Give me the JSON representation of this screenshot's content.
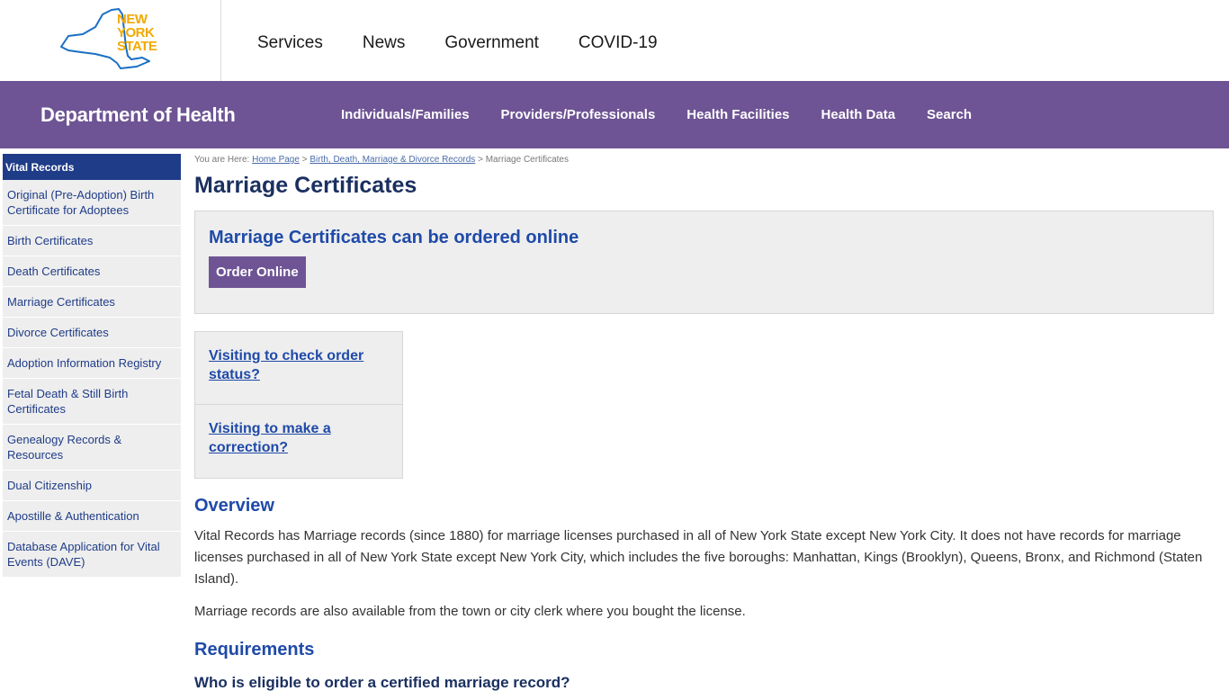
{
  "header": {
    "logo_lines": [
      "NEW",
      "YORK",
      "STATE"
    ],
    "nav": [
      "Services",
      "News",
      "Government",
      "COVID-19"
    ]
  },
  "dept_bar": {
    "title": "Department of Health",
    "nav": [
      "Individuals/Families",
      "Providers/Professionals",
      "Health Facilities",
      "Health Data",
      "Search"
    ]
  },
  "sidebar": {
    "heading": "Vital Records",
    "items": [
      "Original (Pre-Adoption) Birth Certificate for Adoptees",
      "Birth Certificates",
      "Death Certificates",
      "Marriage Certificates",
      "Divorce Certificates",
      "Adoption Information Registry",
      "Fetal Death & Still Birth Certificates",
      "Genealogy Records & Resources",
      "Dual Citizenship",
      "Apostille & Authentication",
      "Database Application for Vital Events (DAVE)"
    ]
  },
  "breadcrumb": {
    "prefix": "You are Here:",
    "home": "Home Page",
    "sep": ">",
    "section": "Birth, Death, Marriage & Divorce Records",
    "current": "Marriage Certificates"
  },
  "main": {
    "title": "Marriage Certificates",
    "order_heading": "Marriage Certificates can be ordered online",
    "order_button": "Order Online",
    "visit_links": [
      "Visiting to check order status?",
      "Visiting to make a correction?"
    ],
    "overview_heading": "Overview",
    "overview_p1": "Vital Records has Marriage records (since 1880) for marriage licenses purchased in all of New York State except New York City. It does not have records for marriage licenses purchased in all of New York State except New York City, which includes the five boroughs: Manhattan, Kings (Brooklyn), Queens, Bronx, and Richmond (Staten Island).",
    "overview_p2": "Marriage records are also available from the town or city clerk where you bought the license.",
    "requirements_heading": "Requirements",
    "cut_heading": "Who is eligible to order a certified marriage record?"
  },
  "colors": {
    "purple": "#6e5494",
    "navy": "#1f3c88",
    "link_blue": "#1f4aa8",
    "logo_gold": "#f2a900",
    "logo_blue": "#1a6fc4"
  }
}
